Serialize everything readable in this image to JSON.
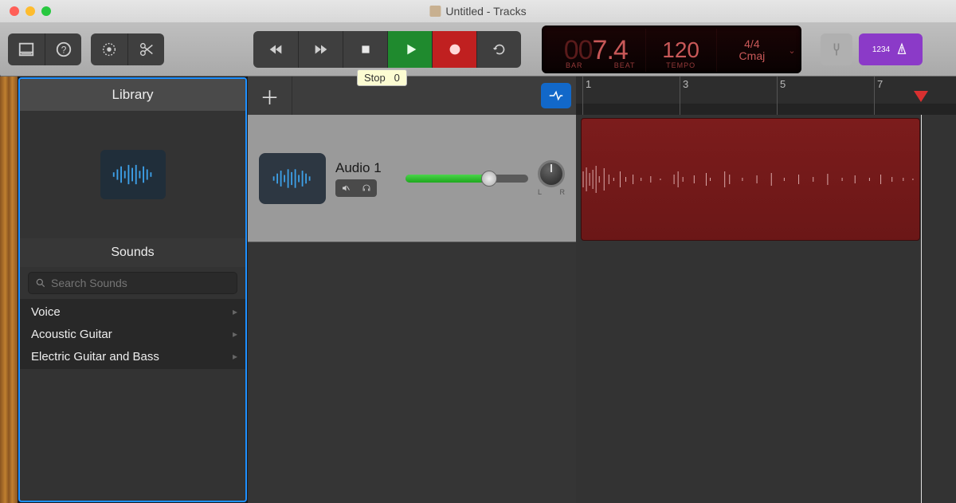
{
  "window": {
    "title": "Untitled - Tracks"
  },
  "transport": {
    "tooltip_stop": "Stop",
    "tooltip_stop_key": "0"
  },
  "lcd": {
    "bar_dim": "00",
    "bar_value": "7.4",
    "bar_label": "BAR",
    "beat_label": "BEAT",
    "tempo": "120",
    "tempo_label": "TEMPO",
    "time_sig": "4/4",
    "key": "Cmaj"
  },
  "count_in": "1234",
  "library": {
    "title": "Library",
    "sounds_title": "Sounds",
    "search_placeholder": "Search Sounds",
    "categories": [
      {
        "label": "Voice"
      },
      {
        "label": "Acoustic Guitar"
      },
      {
        "label": "Electric Guitar and Bass"
      }
    ]
  },
  "ruler_marks": [
    "1",
    "3",
    "5",
    "7"
  ],
  "tracks": [
    {
      "name": "Audio 1"
    }
  ],
  "pan": {
    "left": "L",
    "right": "R"
  }
}
